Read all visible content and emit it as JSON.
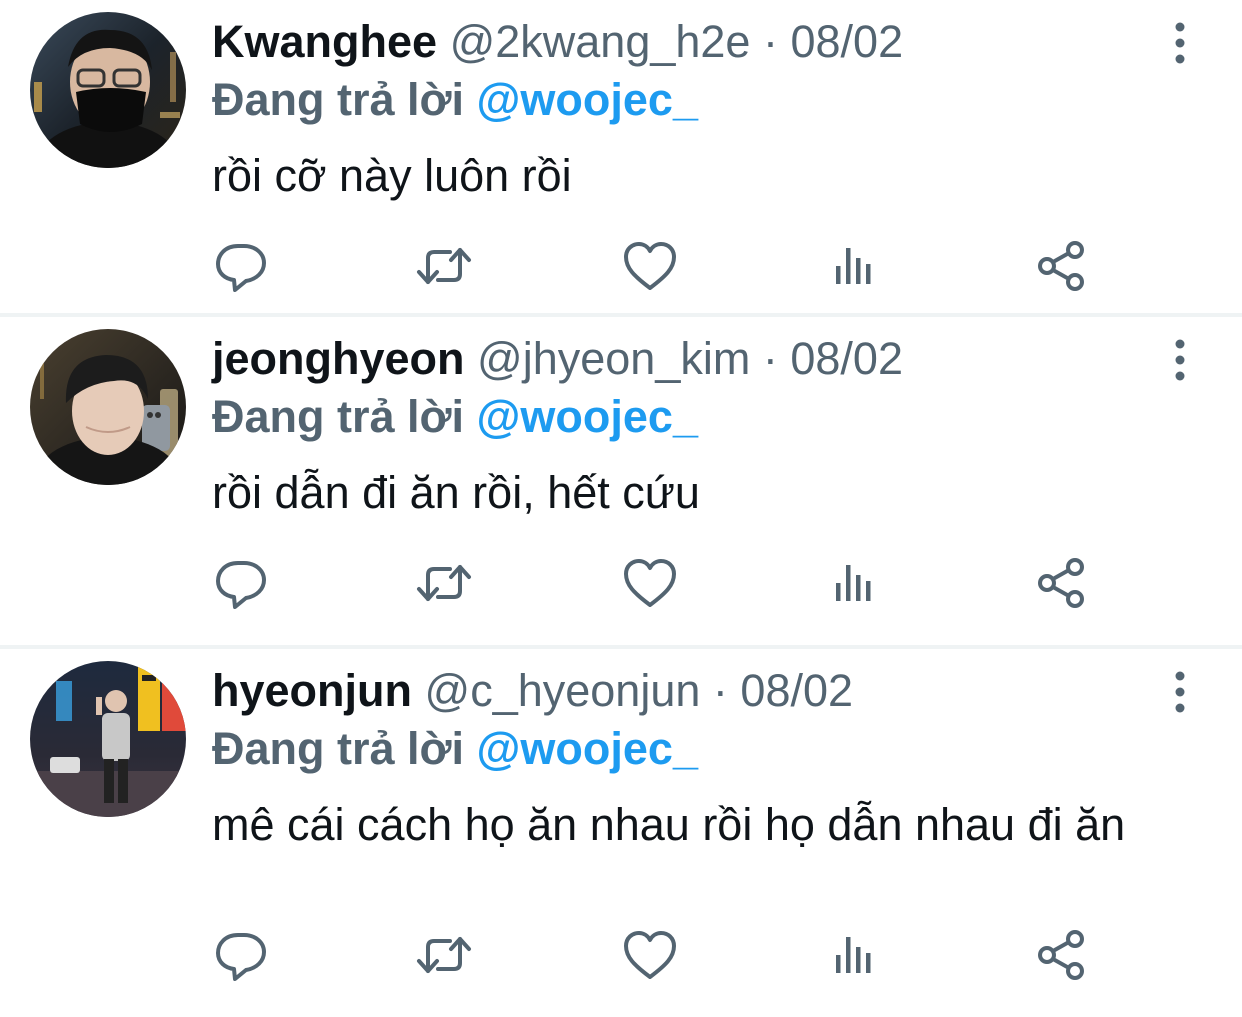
{
  "tweets": [
    {
      "display_name": "Kwanghee",
      "handle": "@2kwang_h2e",
      "separator": "·",
      "date": "08/02",
      "reply_prefix": "Đang trả lời",
      "reply_to": "@woojec_",
      "text": "rồi cỡ này luôn rồi"
    },
    {
      "display_name": "jeonghyeon",
      "handle": "@jhyeon_kim",
      "separator": "·",
      "date": "08/02",
      "reply_prefix": "Đang trả lời",
      "reply_to": "@woojec_",
      "text": "rồi dẫn đi ăn rồi, hết cứu"
    },
    {
      "display_name": "hyeonjun",
      "handle": "@c_hyeonjun",
      "separator": "·",
      "date": "08/02",
      "reply_prefix": "Đang trả lời",
      "reply_to": "@woojec_",
      "text": "mê cái cách họ ăn nhau rồi họ dẫn nhau đi ăn"
    }
  ],
  "actions": [
    "reply-icon",
    "retweet-icon",
    "like-icon",
    "views-icon",
    "share-icon"
  ],
  "colors": {
    "text": "#0f1419",
    "secondary": "#536471",
    "accent": "#1d9bf0",
    "divider": "#eff3f4"
  }
}
